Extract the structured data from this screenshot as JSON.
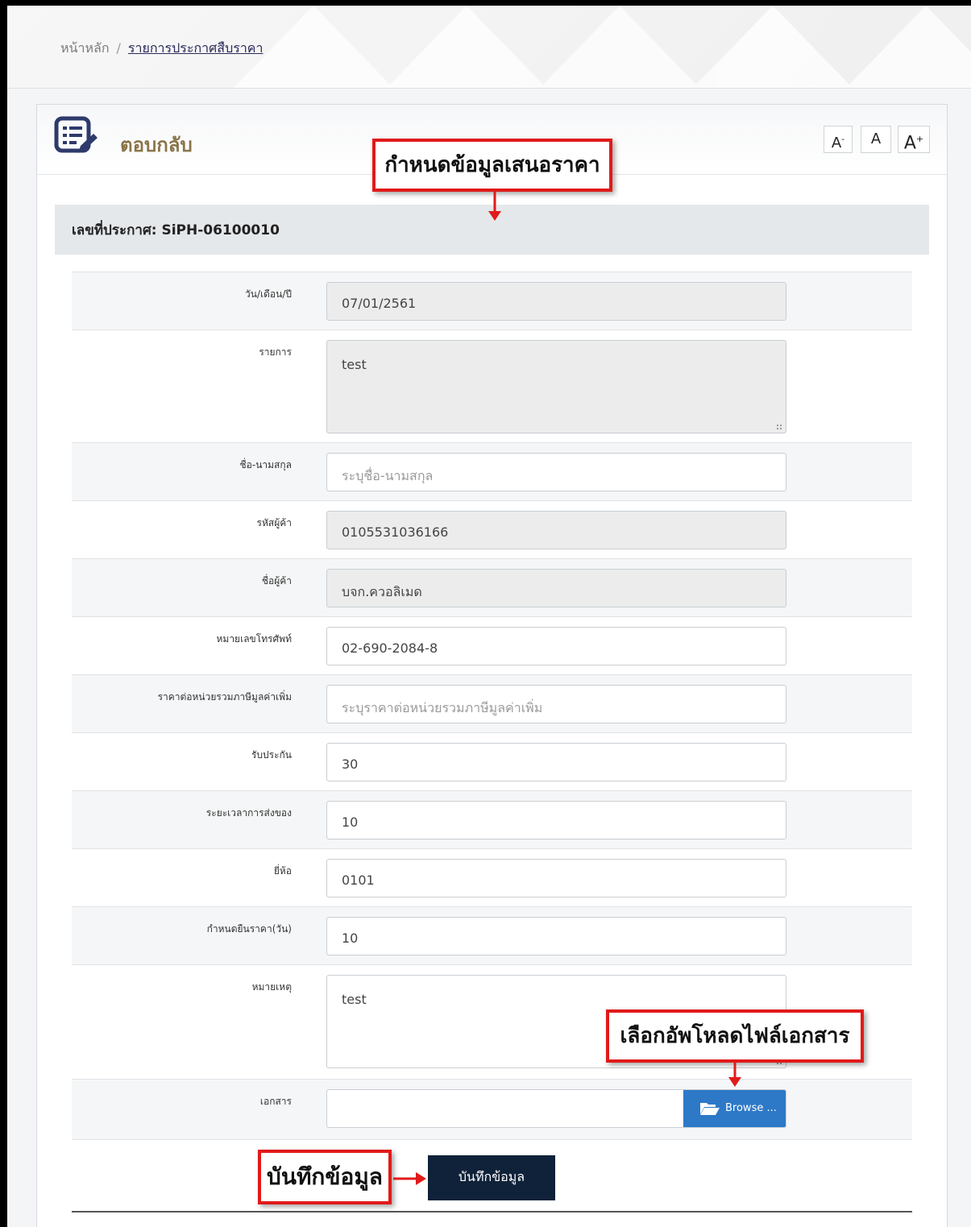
{
  "breadcrumb": {
    "home": "หน้าหลัก",
    "separator": "/",
    "current": "รายการประกาศสืบราคา"
  },
  "card": {
    "title": "ตอบกลับ",
    "font_buttons": {
      "smaller": "A",
      "smaller_sup": "-",
      "normal": "A",
      "larger": "A",
      "larger_sup": "+"
    }
  },
  "section": {
    "announcement": "เลขที่ประกาศ: SiPH-06100010"
  },
  "form": {
    "fields": [
      {
        "label": "วัน/เดือน/ปี",
        "value": "07/01/2561",
        "placeholder": ""
      },
      {
        "label": "รายการ",
        "value": "test",
        "placeholder": ""
      },
      {
        "label": "ชื่อ-นามสกุล",
        "value": "",
        "placeholder": "ระบุชื่อ-นามสกุล"
      },
      {
        "label": "รหัสผู้ค้า",
        "value": "0105531036166",
        "placeholder": ""
      },
      {
        "label": "ชื่อผู้ค้า",
        "value": "บจก.ควอลิเมด",
        "placeholder": ""
      },
      {
        "label": "หมายเลขโทรศัพท์",
        "value": "02-690-2084-8",
        "placeholder": ""
      },
      {
        "label": "ราคาต่อหน่วยรวมภาษีมูลค่าเพิ่ม",
        "value": "",
        "placeholder": "ระบุราคาต่อหน่วยรวมภาษีมูลค่าเพิ่ม"
      },
      {
        "label": "รับประกัน",
        "value": "30",
        "placeholder": ""
      },
      {
        "label": "ระยะเวลาการส่งของ",
        "value": "10",
        "placeholder": ""
      },
      {
        "label": "ยี่ห้อ",
        "value": "0101",
        "placeholder": ""
      },
      {
        "label": "กำหนดยืนราคา(วัน)",
        "value": "10",
        "placeholder": ""
      },
      {
        "label": "หมายเหตุ",
        "value": "test",
        "placeholder": ""
      },
      {
        "label": "เอกสาร",
        "value": "",
        "placeholder": ""
      }
    ],
    "browse_label": "Browse ...",
    "save_label": "บันทึกข้อมูล"
  },
  "callouts": {
    "set_offer": "กำหนดข้อมูลเสนอราคา",
    "upload": "เลือกอัพโหลดไฟล์เอกสาร",
    "save": "บันทึกข้อมูล"
  },
  "colors": {
    "title": "#8a7448",
    "browse": "#2d79c7",
    "save": "#0f2239",
    "callout_border": "#e11a1a"
  }
}
